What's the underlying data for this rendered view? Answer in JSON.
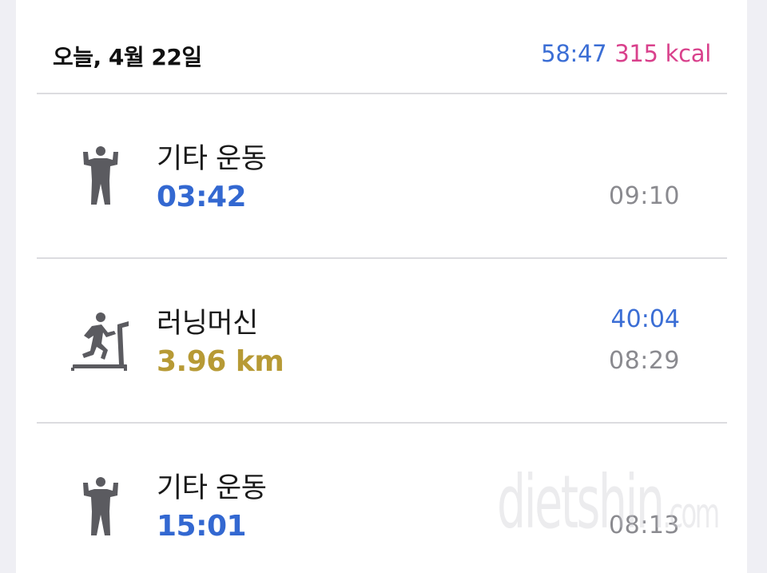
{
  "header": {
    "date": "오늘, 4월 22일",
    "total_duration": "58:47",
    "total_kcal": "315 kcal"
  },
  "workouts": [
    {
      "name": "기타 운동",
      "metric": "03:42",
      "time": "09:10",
      "icon": "strength-figure-icon"
    },
    {
      "name": "러닝머신",
      "metric": "3.96 km",
      "duration": "40:04",
      "time": "08:29",
      "icon": "treadmill-runner-icon"
    },
    {
      "name": "기타 운동",
      "metric": "15:01",
      "time": "08:13",
      "icon": "strength-figure-icon"
    }
  ],
  "watermark": "dietshin",
  "watermark_suffix": ".com",
  "colors": {
    "duration_blue": "#3368d1",
    "kcal_pink": "#d9418c",
    "distance_gold": "#b79a35",
    "icon_gray": "#5b5b60"
  }
}
